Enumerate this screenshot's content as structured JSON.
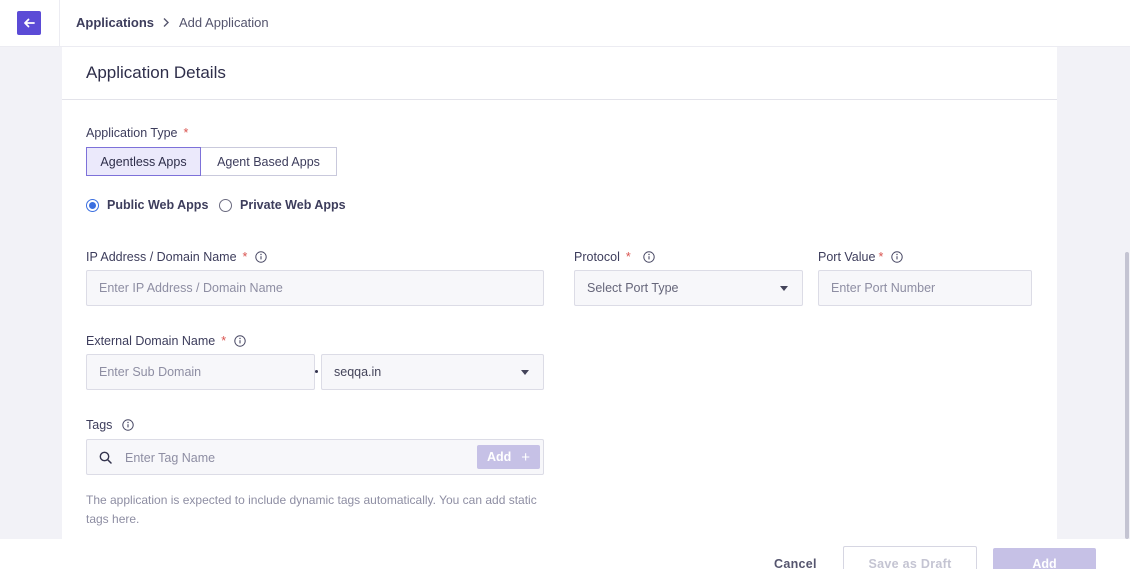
{
  "breadcrumb": {
    "root": "Applications",
    "current": "Add Application"
  },
  "card": {
    "title": "Application Details"
  },
  "application_type": {
    "label": "Application Type",
    "required_mark": "*",
    "options": [
      "Agentless Apps",
      "Agent Based Apps"
    ],
    "selected": "Agentless Apps"
  },
  "web_app_type": {
    "options": [
      "Public Web Apps",
      "Private Web Apps"
    ],
    "selected": "Public Web Apps"
  },
  "ip_address": {
    "label": "IP Address / Domain Name",
    "required_mark": "*",
    "placeholder": "Enter IP Address / Domain Name"
  },
  "protocol": {
    "label": "Protocol",
    "required_mark": "*",
    "placeholder": "Select Port Type"
  },
  "port_value": {
    "label": "Port Value",
    "required_mark": "*",
    "placeholder": "Enter Port Number"
  },
  "external_domain": {
    "label": "External Domain Name",
    "required_mark": "*",
    "sub_placeholder": "Enter Sub Domain",
    "domain_value": "seqqa.in"
  },
  "tags": {
    "label": "Tags",
    "placeholder": "Enter Tag Name",
    "add_label": "Add",
    "add_icon": "+",
    "hint": "The application is expected to include dynamic tags automatically. You can add static tags here."
  },
  "footer": {
    "cancel": "Cancel",
    "save_draft": "Save as Draft",
    "add": "Add"
  },
  "colors": {
    "accent": "#5b4bd6",
    "radio_selected": "#3b6fe0",
    "required": "#d9534f",
    "disabled_button": "#c6c1e6"
  },
  "icons": {
    "back": "arrow-left-icon",
    "breadcrumb_separator": "chevron-right-icon",
    "info": "info-icon",
    "search": "search-icon",
    "dropdown": "caret-down-icon"
  }
}
